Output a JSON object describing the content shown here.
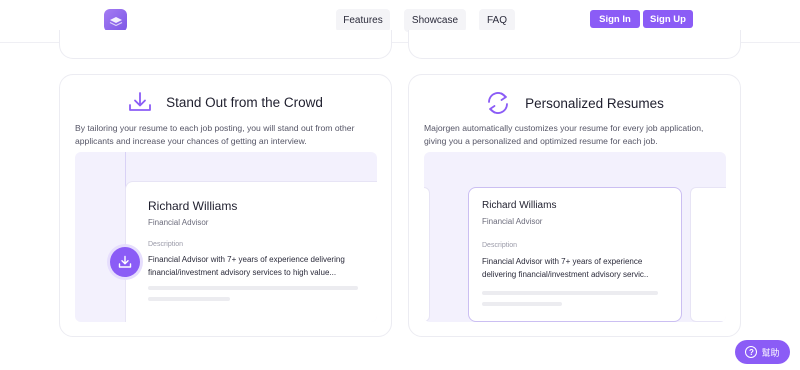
{
  "nav": {
    "features": "Features",
    "showcase": "Showcase",
    "faq": "FAQ",
    "sign_in": "Sign In",
    "sign_up": "Sign Up"
  },
  "cards": [
    {
      "title": "Stand Out from the Crowd",
      "description": "By tailoring your resume to each job posting, you will stand out from other applicants and increase your chances of getting an interview.",
      "resume": {
        "name": "Richard Williams",
        "role": "Financial Advisor",
        "section_label": "Description",
        "text": "Financial Advisor with 7+ years of experience delivering financial/investment advisory services to high value..."
      }
    },
    {
      "title": "Personalized Resumes",
      "description": "Majorgen automatically customizes your resume for every job application, giving you a personalized and optimized resume for each job.",
      "resume": {
        "name": "Richard Williams",
        "role": "Financial Advisor",
        "section_label": "Description",
        "text": "Financial Advisor with 7+ years of experience delivering financial/investment advisory servic.."
      }
    }
  ],
  "help": {
    "label": "幫助"
  },
  "colors": {
    "accent": "#8b5cf6",
    "preview_bg": "#f3f1fd"
  }
}
